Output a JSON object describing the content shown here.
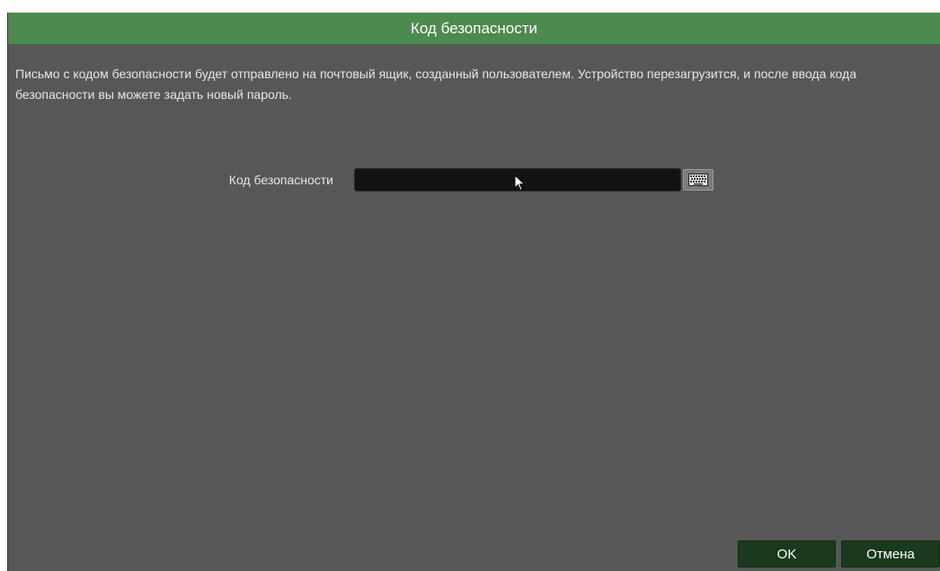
{
  "dialog": {
    "title": "Код безопасности",
    "message": "Письмо с кодом безопасности будет отправлено на почтовый ящик, созданный пользователем. Устройство перезагрузится, и после ввода кода безопасности вы можете задать новый пароль.",
    "security_code": {
      "label": "Код безопасности",
      "value": "",
      "placeholder": ""
    },
    "ok_label": "OK",
    "cancel_label": "Отмена"
  },
  "icons": {
    "keyboard": "keyboard-icon",
    "cursor": "mouse-pointer-icon"
  },
  "colors": {
    "titlebar": "#4d8a4f",
    "panel": "#575757",
    "input": "#131316",
    "button": "#1a3a1d"
  }
}
